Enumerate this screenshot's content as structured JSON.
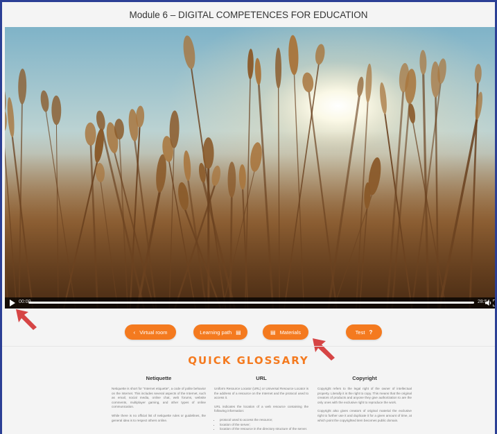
{
  "page": {
    "title": "Module 6 – DIGITAL COMPETENCES FOR EDUCATION"
  },
  "video": {
    "current_time": "00:00",
    "duration": "28:54",
    "progress": 0.0,
    "icons": {
      "play": "play-icon",
      "volume": "volume-icon",
      "fullscreen": "fullscreen-icon"
    }
  },
  "nav": {
    "virtual_room": "Virtual room",
    "learning_path": "Learning path",
    "materials": "Materials",
    "test": "Test",
    "icons": {
      "virtual_room": "chevron-left-icon",
      "learning_path": "document-icon",
      "materials": "document-icon",
      "test": "question-icon"
    }
  },
  "glossary": {
    "title": "QUICK GLOSSARY",
    "netiquette": {
      "heading": "Netiquette",
      "p1": "Netiquette is short for \"Internet etiquette\", a code of polite behavior on the Internet. This includes several aspects of the Internet, such as email, social media, online chat, web forums, website comments, multiplayer gaming, and other types of online communication.",
      "p2": "While there is no official list of netiquette rules or guidelines, the general idea is to respect others online."
    },
    "url": {
      "heading": "URL",
      "p1": "Uniform Resource Locator (URL) or Universal Resource Locator is the address of a resource on the Internet and the protocol used to access it.",
      "p2": "URL indicates the location of a web resource containing the following information:",
      "items": [
        "protocol used to access the resource;",
        "location of the server;",
        "location of the resource in the directory structure of the server."
      ]
    },
    "copyright": {
      "heading": "Copyright",
      "p1": "Copyright refers to the legal right of the owner of intellectual property. Literally it is the right to copy. This means that the original creators of products and anyone they give authorization to are the only ones with the exclusive right to reproduce the work.",
      "p2": "Copyright also gives creators of original material the exclusive right to further use it and duplicate it for a given amount of time, at which point the copyrighted item becomes public domain."
    }
  },
  "colors": {
    "accent": "#f47a1f",
    "arrow": "#d64545",
    "frame": "#2b3f95"
  }
}
